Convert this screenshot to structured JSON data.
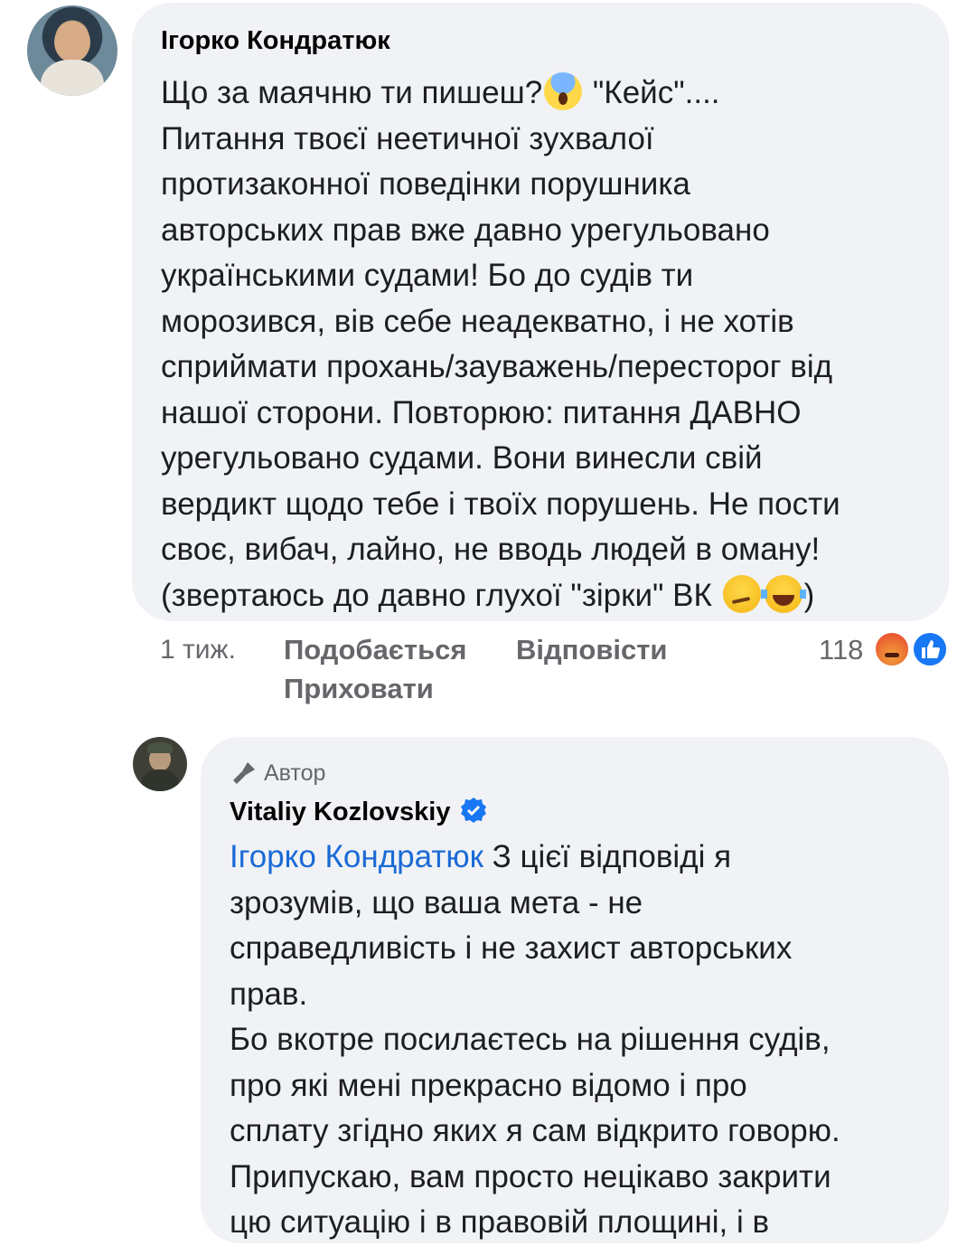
{
  "comment1": {
    "author": "Ігорко Кондратюк",
    "lines": [
      "Що за маячню ти пишеш?",
      "Питання твоєї неетичної зухвалої",
      "протизаконної поведінки порушника",
      "авторських прав вже давно урегульовано",
      "українськими судами! Бо до судів ти",
      "морозився, вів себе неадекватно, і не хотів",
      "сприймати прохань/зауважень/пересторог від",
      "нашої сторони. Повторюю: питання ДАВНО",
      "урегульовано судами. Вони винесли свій",
      "вердикт щодо тебе і твоїх порушень. Не пости",
      "своє, вибач, лайно, не вводь людей в оману!",
      "(звертаюсь до давно глухої \"зірки\" ВК"
    ],
    "line1_suffix": " \"Кейс\"....",
    "line12_suffix": ")",
    "time": "1 тиж.",
    "like_label": "Подобається",
    "reply_label": "Відповісти",
    "hide_label": "Приховати",
    "reaction_count": "118",
    "icons": [
      "scream-emoji",
      "thinking-emoji",
      "laughing-emoji",
      "angry-reaction-icon",
      "like-reaction-icon"
    ]
  },
  "comment2": {
    "badge": "Автор",
    "author": "Vitaliy Kozlovskiy",
    "mention": "Ігорко Кондратюк",
    "line1_rest": " З цієї відповіді я",
    "lines": [
      "зрозумів, що ваша мета - не",
      "справедливість і не захист авторських",
      "прав.",
      "Бо вкотре посилаєтесь на рішення судів,",
      "про які мені прекрасно відомо і про",
      "сплату згідно яких я сам відкрито говорю.",
      "Припускаю, вам просто нецікаво закрити",
      "цю ситуацію і в правовій площині, і в"
    ],
    "verified_color": "#1877f2"
  }
}
